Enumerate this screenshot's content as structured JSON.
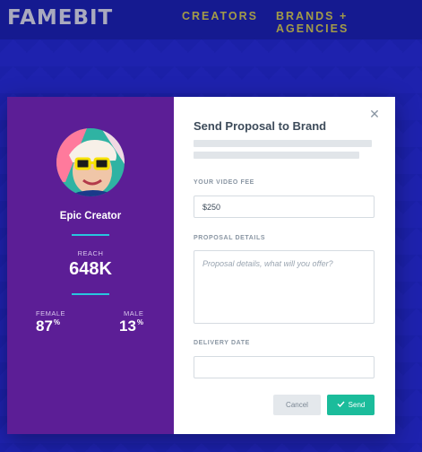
{
  "header": {
    "logo": "FAMEBIT",
    "nav": [
      "CREATORS",
      "BRANDS + AGENCIES"
    ]
  },
  "creator": {
    "name": "Epic Creator",
    "reach_label": "REACH",
    "reach_value": "648K",
    "female_label": "FEMALE",
    "female_value": "87",
    "male_label": "MALE",
    "male_value": "13",
    "percent_symbol": "%"
  },
  "proposal": {
    "title": "Send Proposal to Brand",
    "close_icon": "close-icon",
    "video_fee_label": "YOUR VIDEO FEE",
    "video_fee_value": "$250",
    "details_label": "PROPOSAL DETAILS",
    "details_placeholder": "Proposal details, what will you offer?",
    "delivery_label": "DELIVERY DATE",
    "delivery_value": "",
    "cancel_label": "Cancel",
    "send_label": "Send",
    "send_icon": "check-icon"
  },
  "colors": {
    "background": "#2a2fe6",
    "topbar": "#1c23b8",
    "nav_text": "#f5e64a",
    "profile_panel": "#5c1e96",
    "accent": "#28c6de",
    "send_button": "#1bbc9b"
  }
}
